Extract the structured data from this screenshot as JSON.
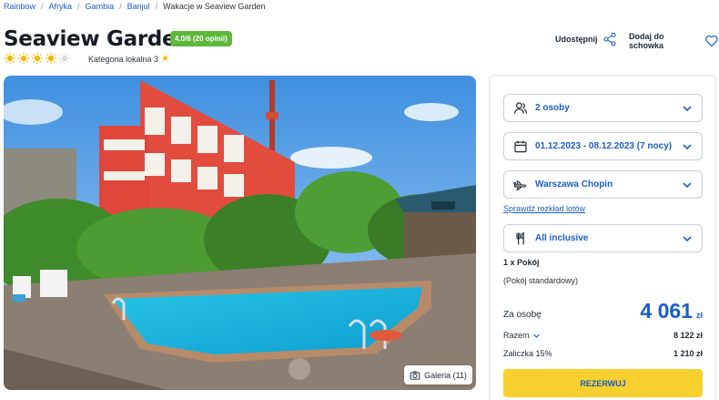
{
  "breadcrumb": {
    "items": [
      "Rainbow",
      "Afryka",
      "Gambia",
      "Banjul"
    ],
    "current": "Wakacje w Seaview Garden",
    "separator": "/"
  },
  "hotel": {
    "name": "Seaview Garden",
    "rating_badge": "4.0/6 (20 opinii)",
    "suns_rating": 4.5,
    "suns_max": 5,
    "category": "Kategoria lokalna 3"
  },
  "actions": {
    "share": "Udostępnij",
    "favorite": "Dodaj do schowka"
  },
  "gallery": {
    "label": "Galeria (11)"
  },
  "booking": {
    "guests": "2 osoby",
    "dates": "01.12.2023 - 08.12.2023 (7 nocy)",
    "departure": "Warszawa Chopin",
    "flights_link": "Sprawdź rozkład lotów",
    "board": "All inclusive",
    "room_count": "1 x Pokój",
    "room_type": "(Pokój standardowy)",
    "per_person_label": "Za osobę",
    "per_person_price": "4 061",
    "currency": "zł",
    "total_label": "Razem",
    "total_value": "8 122 zł",
    "deposit_label": "Zaliczka 15%",
    "deposit_value": "1 210 zł",
    "reserve_button": "REZERWUJ"
  },
  "colors": {
    "accent_blue": "#1a5fc4",
    "rating_green": "#5db83a",
    "reserve_yellow": "#f7cf2e",
    "sun_yellow": "#f5b800"
  },
  "icons": {
    "share": "share-icon",
    "favorite": "heart-icon",
    "guests": "user-icon",
    "dates": "calendar-icon",
    "departure": "plane-icon",
    "board": "cutlery-icon",
    "gallery": "camera-icon"
  }
}
